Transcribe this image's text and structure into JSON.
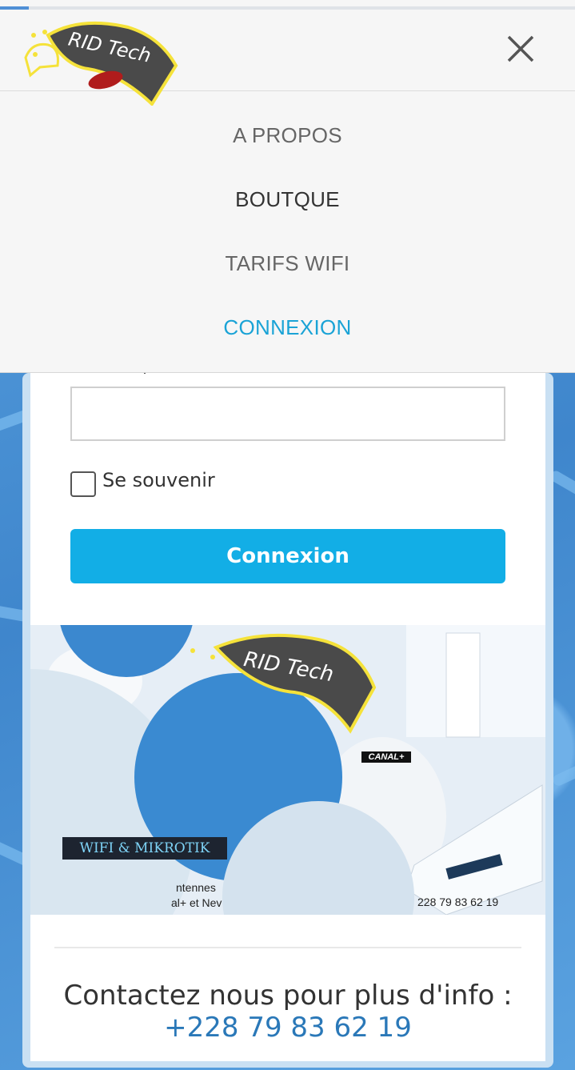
{
  "header": {
    "logo_text": "RID Tech"
  },
  "menu": {
    "items": [
      {
        "label": "A PROPOS",
        "color": "#666666"
      },
      {
        "label": "BOUTQUE",
        "color": "#333333"
      },
      {
        "label": "TARIFS WIFI",
        "color": "#666666"
      },
      {
        "label": "CONNEXION",
        "color": "#1aa3d6"
      }
    ]
  },
  "form": {
    "input_value": "",
    "remember_label": "Se souvenir",
    "remember_checked": false,
    "submit_label": "Connexion"
  },
  "banner": {
    "logo_text": "RID Tech",
    "tag": "WIFI & MIKROTIK",
    "canal_badge": "CANAL+",
    "fragment_1": "ntennes",
    "fragment_2": "al+ et Nev",
    "phone_small": "228 79 83 62 19"
  },
  "contact": {
    "text": "Contactez nous pour plus d'info :",
    "phone": "+228 79 83 62 19"
  },
  "colors": {
    "accent": "#12aee6",
    "link": "#2a78b8"
  }
}
